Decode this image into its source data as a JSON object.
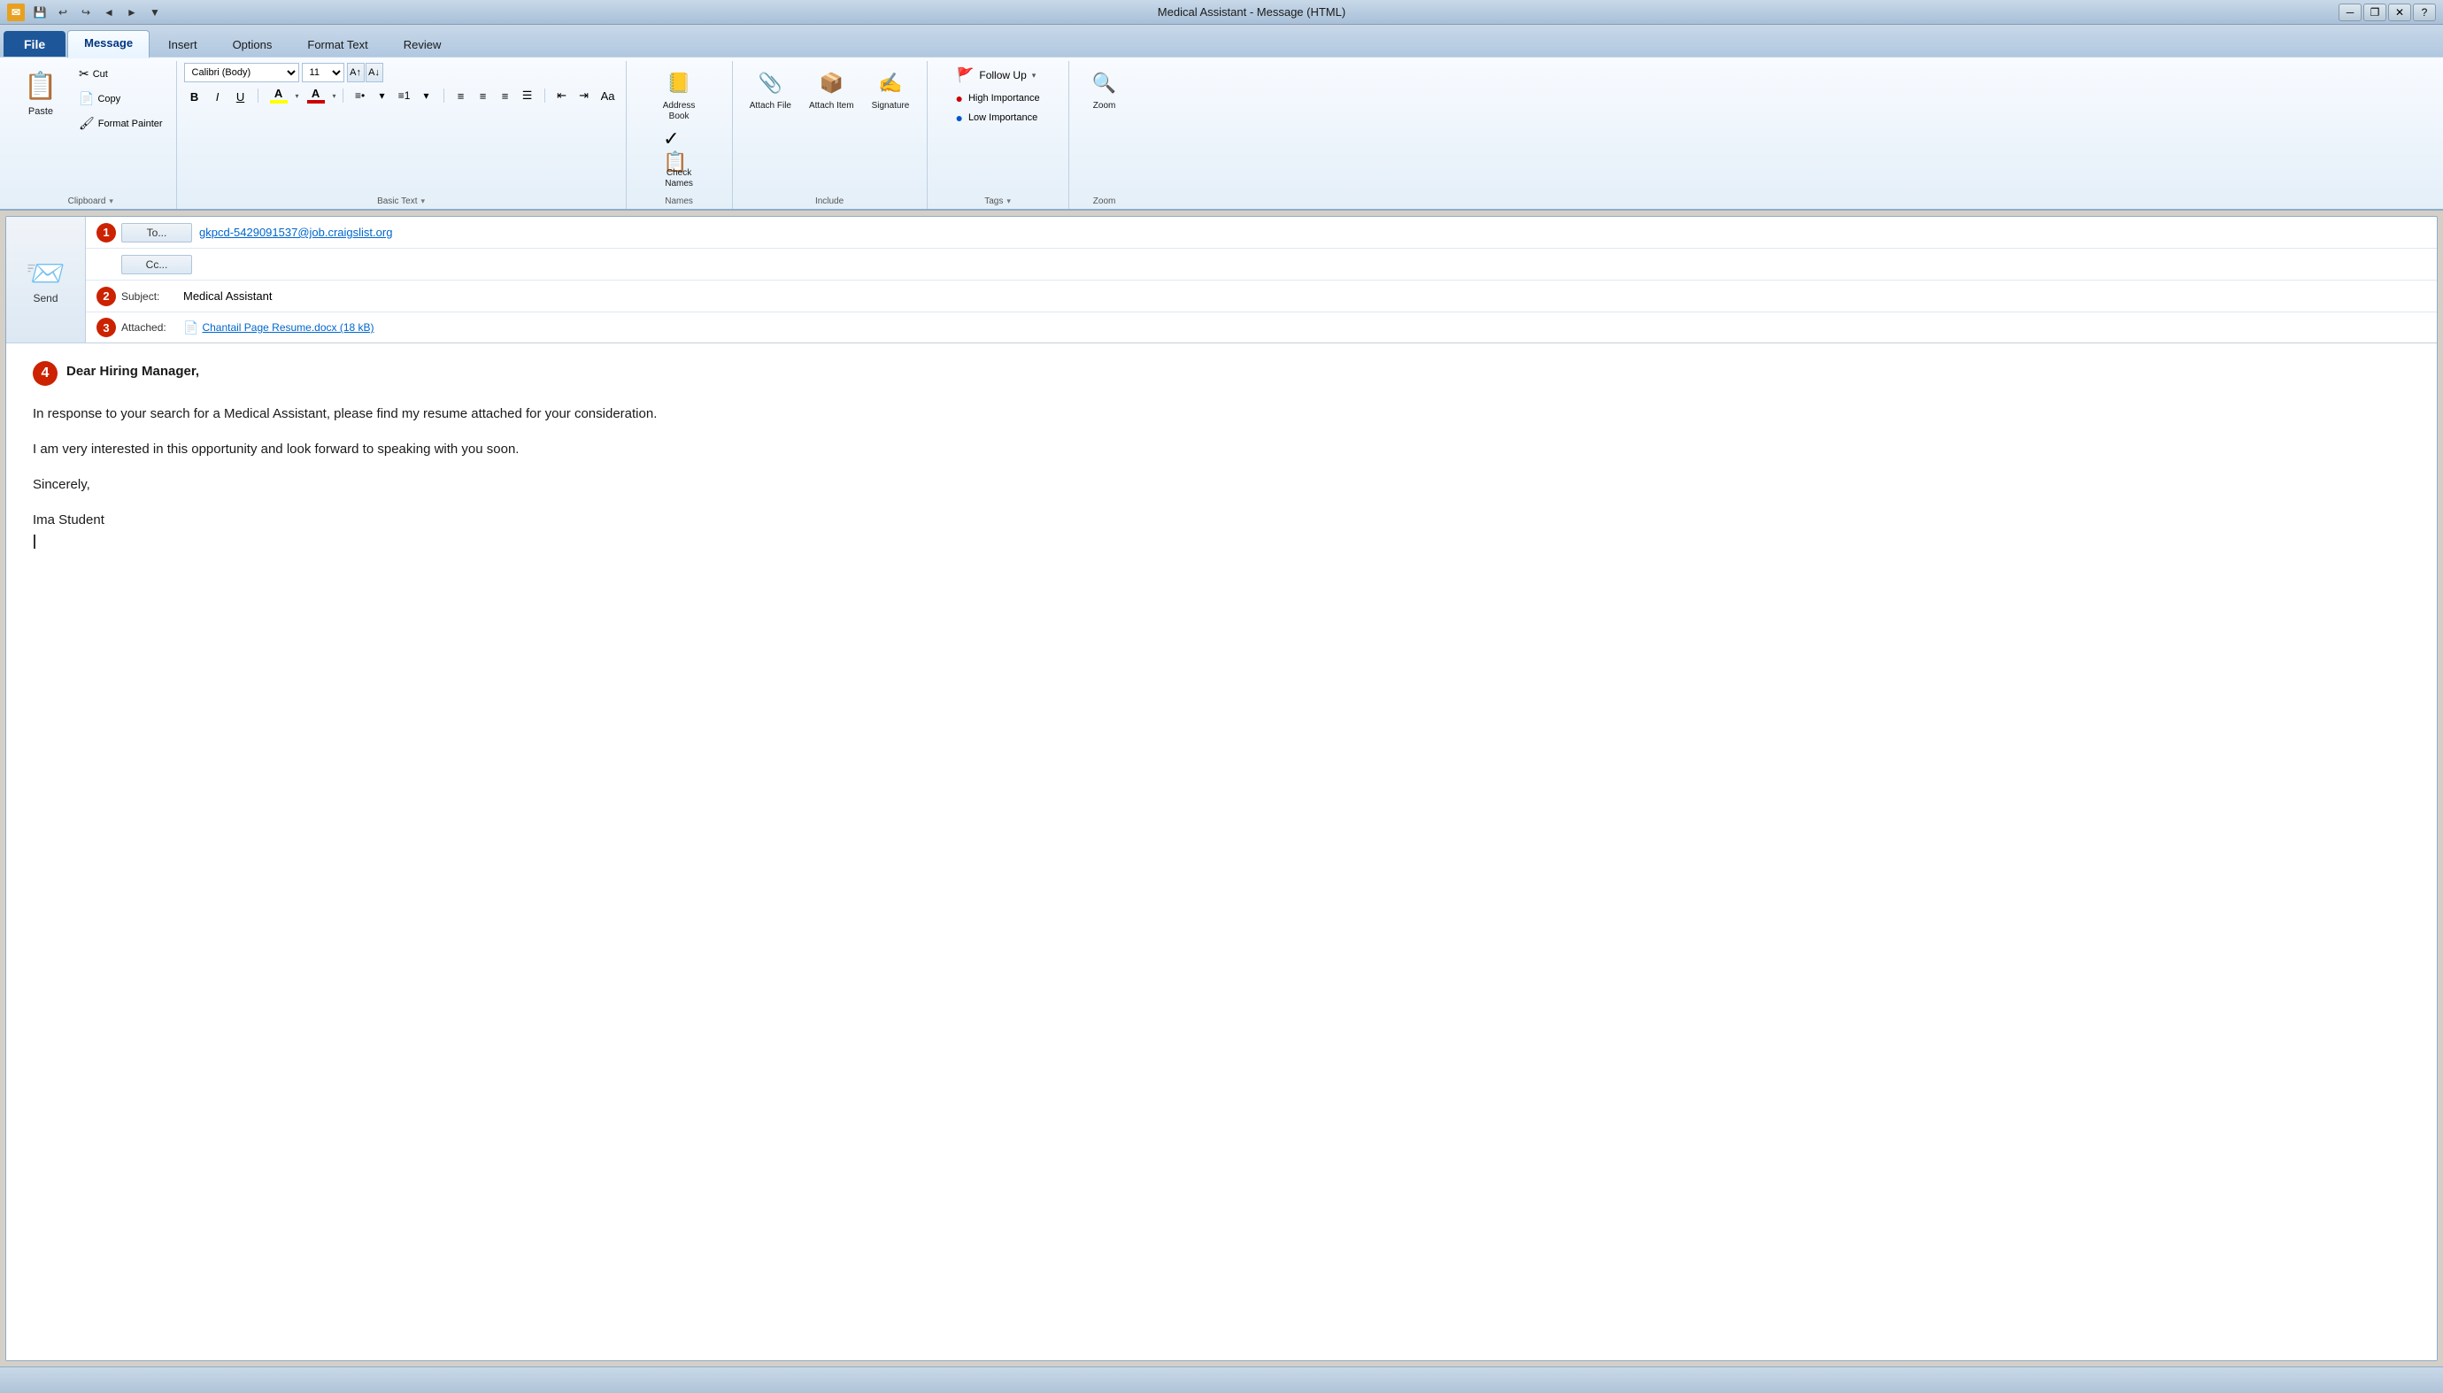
{
  "titlebar": {
    "title": "Medical Assistant - Message (HTML)",
    "min_label": "─",
    "max_label": "□",
    "close_label": "✕",
    "restore_label": "❐"
  },
  "ribbon": {
    "tabs": [
      {
        "label": "File",
        "active": false,
        "file": true
      },
      {
        "label": "Message",
        "active": true
      },
      {
        "label": "Insert",
        "active": false
      },
      {
        "label": "Options",
        "active": false
      },
      {
        "label": "Format Text",
        "active": false
      },
      {
        "label": "Review",
        "active": false
      }
    ],
    "groups": {
      "clipboard": {
        "label": "Clipboard",
        "paste_label": "Paste",
        "cut_label": "Cut",
        "copy_label": "Copy",
        "format_painter_label": "Format Painter"
      },
      "basic_text": {
        "label": "Basic Text",
        "font": "Calibri (Body)",
        "font_size": "11",
        "bold": "B",
        "italic": "I",
        "underline": "U",
        "highlight_label": "A",
        "font_color_label": "A"
      },
      "names": {
        "label": "Names",
        "address_book_label": "Address Book",
        "check_names_label": "Check Names"
      },
      "include": {
        "label": "Include",
        "attach_file_label": "Attach File",
        "attach_item_label": "Attach Item",
        "signature_label": "Signature"
      },
      "tags": {
        "label": "Tags",
        "follow_up_label": "Follow Up",
        "high_importance_label": "High Importance",
        "low_importance_label": "Low Importance"
      },
      "zoom": {
        "label": "Zoom",
        "zoom_label": "Zoom"
      }
    }
  },
  "compose": {
    "to_label": "To...",
    "to_value": "gkpcd-5429091537@job.craigslist.org",
    "cc_label": "Cc...",
    "subject_label": "Subject:",
    "subject_value": "Medical Assistant",
    "attached_label": "Attached:",
    "attached_file": "Chantail Page Resume.docx (18 kB)",
    "send_label": "Send",
    "numbers": {
      "n1": "1",
      "n2": "2",
      "n3": "3",
      "n4": "4"
    }
  },
  "body": {
    "greeting": "Dear Hiring Manager,",
    "paragraph1": "In response to your search for a Medical Assistant, please find my resume attached for your consideration.",
    "paragraph2": "I am very interested in this opportunity and look forward to speaking with you soon.",
    "closing": "Sincerely,",
    "signature": "Ima Student"
  },
  "status": {
    "text": ""
  }
}
